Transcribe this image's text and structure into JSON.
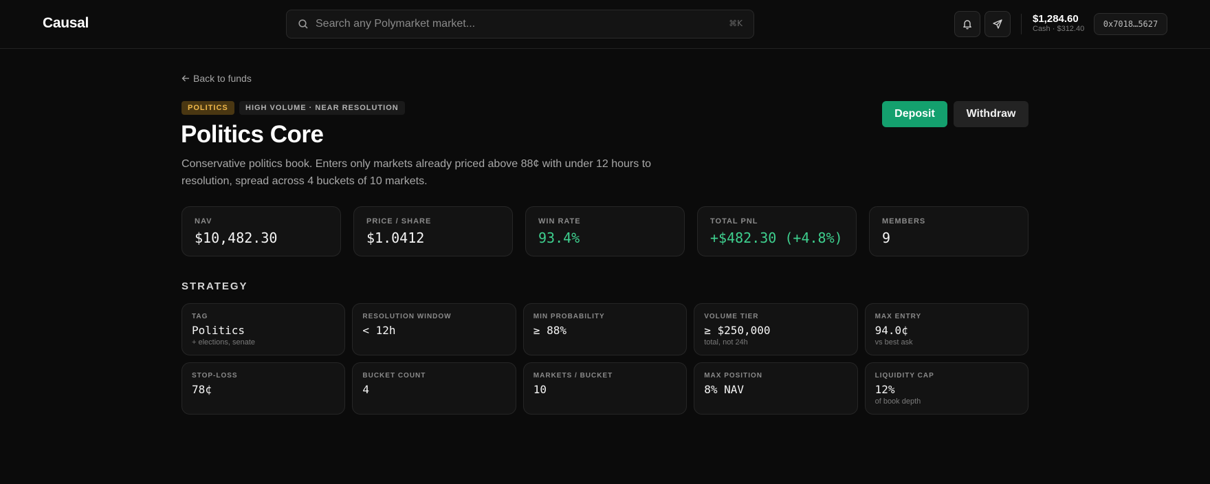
{
  "app": {
    "logo": "Causal"
  },
  "search": {
    "placeholder": "Search any Polymarket market...",
    "shortcut": "⌘K"
  },
  "header": {
    "icons": {
      "notifications": "bell-icon",
      "send": "paper-plane-icon",
      "search": "search-icon"
    },
    "balance": "$1,284.60",
    "cash": "Cash · $312.40",
    "wallet": "0x7018…5627"
  },
  "nav": {
    "back_label": "Back to funds",
    "back_icon": "arrow-left-icon"
  },
  "fund": {
    "category_badge": "POLITICS",
    "tags_badge": "HIGH VOLUME · NEAR RESOLUTION",
    "title": "Politics Core",
    "description": "Conservative politics book. Enters only markets already priced above 88¢ with under 12 hours to resolution, spread across 4 buckets of 10 markets."
  },
  "actions": {
    "deposit_label": "Deposit",
    "withdraw_label": "Withdraw"
  },
  "stats": [
    {
      "label": "NAV",
      "value": "$10,482.30",
      "color": "#f5f5f5"
    },
    {
      "label": "PRICE / SHARE",
      "value": "$1.0412",
      "color": "#f5f5f5"
    },
    {
      "label": "WIN RATE",
      "value": "93.4%",
      "color": "#3ecf8e"
    },
    {
      "label": "TOTAL PNL",
      "value": "+$482.30 (+4.8%)",
      "color": "#3ecf8e"
    },
    {
      "label": "MEMBERS",
      "value": "9",
      "color": "#f5f5f5"
    }
  ],
  "strategy": {
    "title": "STRATEGY",
    "items": [
      {
        "label": "TAG",
        "value": "Politics",
        "sub": "+ elections, senate"
      },
      {
        "label": "RESOLUTION WINDOW",
        "value": "< 12h",
        "sub": ""
      },
      {
        "label": "MIN PROBABILITY",
        "value": "≥ 88%",
        "sub": ""
      },
      {
        "label": "VOLUME TIER",
        "value": "≥ $250,000",
        "sub": "total, not 24h"
      },
      {
        "label": "MAX ENTRY",
        "value": "94.0¢",
        "sub": "vs best ask"
      },
      {
        "label": "STOP-LOSS",
        "value": "78¢",
        "sub": ""
      },
      {
        "label": "BUCKET COUNT",
        "value": "4",
        "sub": ""
      },
      {
        "label": "MARKETS / BUCKET",
        "value": "10",
        "sub": ""
      },
      {
        "label": "MAX POSITION",
        "value": "8% NAV",
        "sub": ""
      },
      {
        "label": "LIQUIDITY CAP",
        "value": "12%",
        "sub": "of book depth"
      }
    ]
  },
  "colors": {
    "accent": "#14a06e",
    "positive": "#3ecf8e",
    "badge_politics": "#f0b84a"
  }
}
